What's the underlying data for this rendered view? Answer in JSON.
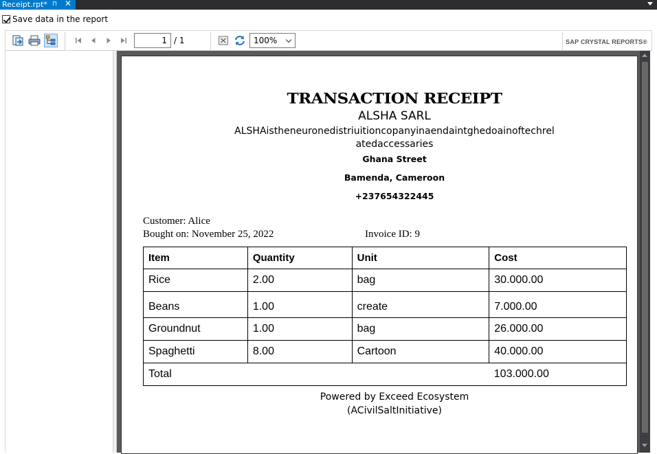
{
  "tabbar": {
    "tab_title": "Receipt.rpt*",
    "pin_glyph": "⊓",
    "close_glyph": "✕"
  },
  "options": {
    "save_data_label": "Save data in the report",
    "save_data_checked": true
  },
  "toolbar": {
    "current_page": "1",
    "page_total": "/ 1",
    "zoom": "100%",
    "brand": "SAP CRYSTAL REPORTS®"
  },
  "report": {
    "title": "TRANSACTION RECEIPT",
    "company": "ALSHA SARL",
    "description": "ALSHAistheneuronedistriuitioncopanyinaendaintghedoainoftechrel atedaccessaries",
    "street": "Ghana Street",
    "city": "Bamenda, Cameroon",
    "phone": "+237654322445",
    "customer_line": "Customer: Alice",
    "date_line": "Bought on: November 25, 2022",
    "invoice_line": "Invoice ID: 9",
    "columns": [
      "Item",
      "Quantity",
      "Unit",
      "Cost"
    ],
    "rows": [
      {
        "item": "Rice",
        "quantity": "2.00",
        "unit": "bag",
        "cost": "30.000.00"
      },
      {
        "item": "Beans",
        "quantity": "1.00",
        "unit": "create",
        "cost": "7.000.00"
      },
      {
        "item": "Groundnut",
        "quantity": "1.00",
        "unit": "bag",
        "cost": "26.000.00"
      },
      {
        "item": "Spaghetti",
        "quantity": "8.00",
        "unit": "Cartoon",
        "cost": "40.000.00"
      }
    ],
    "total_label": "Total",
    "total_value": "103.000.00",
    "powered_by": "Powered by Exceed Ecosystem",
    "initiative": "(ACivilSaltInitiative)"
  },
  "colors": {
    "tab_active": "#007acc",
    "ide_dark": "#2d2d30",
    "report_background": "#5a5a5a"
  }
}
